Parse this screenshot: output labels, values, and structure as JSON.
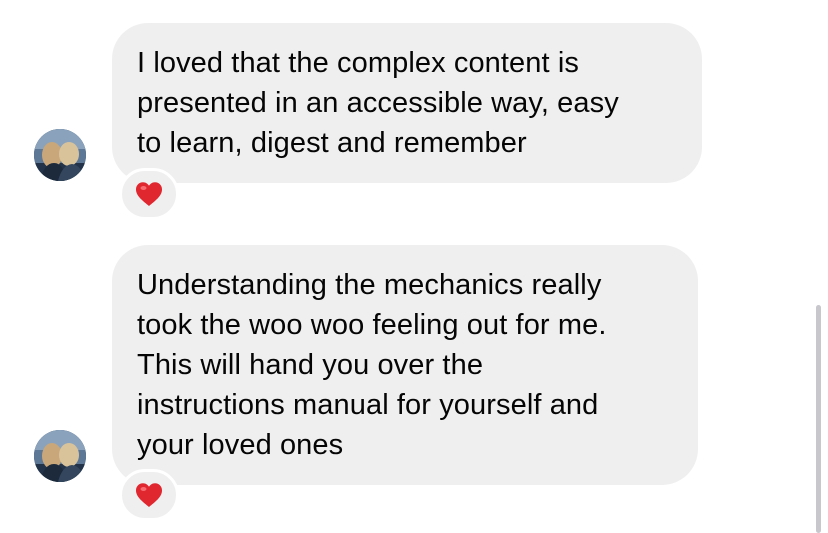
{
  "messages": [
    {
      "text": "I loved that the complex content is\npresented in an accessible way, easy\nto learn, digest and remember",
      "reaction": "heart-emoji",
      "avatar": "sender-avatar"
    },
    {
      "text": "Understanding the mechanics really\ntook the woo woo feeling out for me.\nThis will hand you over the\ninstructions manual for yourself and\nyour loved ones",
      "reaction": "heart-emoji",
      "avatar": "sender-avatar"
    }
  ],
  "colors": {
    "bubble_background": "#efeff0",
    "text": "#050505",
    "heart": "#e0262e",
    "scrollbar": "#c7c7cc"
  }
}
